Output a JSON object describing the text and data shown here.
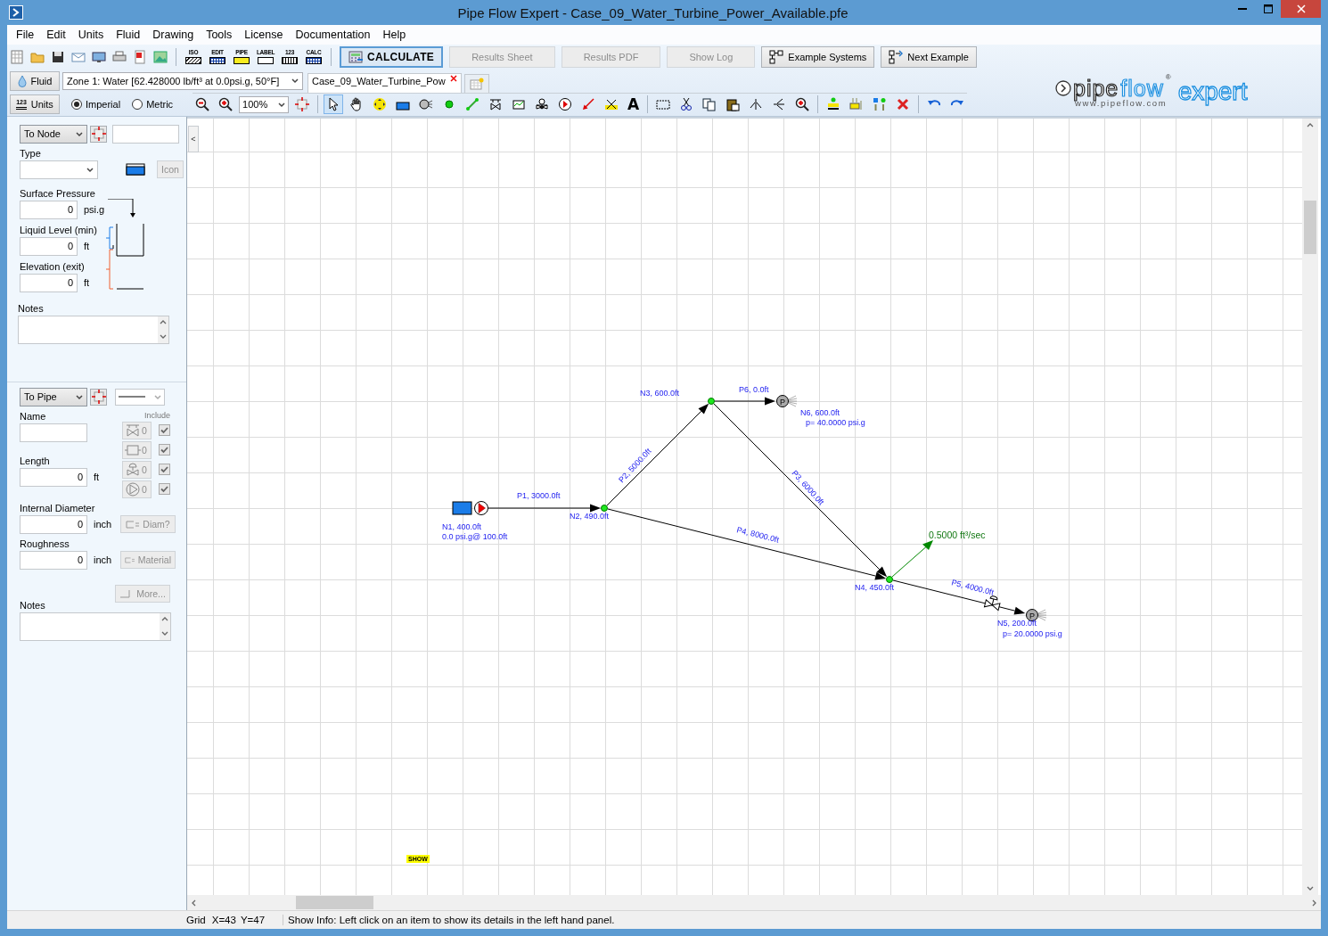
{
  "window": {
    "title": "Pipe Flow Expert - Case_09_Water_Turbine_Power_Available.pfe"
  },
  "menu": [
    "File",
    "Edit",
    "Units",
    "Fluid",
    "Drawing",
    "Tools",
    "License",
    "Documentation",
    "Help"
  ],
  "toolbar": {
    "file_icons": [
      {
        "kind": "new"
      },
      {
        "kind": "open"
      },
      {
        "kind": "save"
      },
      {
        "kind": "email"
      },
      {
        "kind": "export"
      },
      {
        "kind": "print"
      },
      {
        "kind": "pdf"
      },
      {
        "kind": "image"
      }
    ],
    "mode_buttons": [
      {
        "text": "ISO",
        "kind": "hatch"
      },
      {
        "text": "EDIT",
        "kind": "grid"
      },
      {
        "text": "PIPE",
        "kind": "yellow"
      },
      {
        "text": "LABEL",
        "kind": "check"
      },
      {
        "text": "123",
        "kind": "ruler"
      },
      {
        "text": "CALC",
        "kind": "grid"
      }
    ],
    "buttons": [
      {
        "label": "CALCULATE",
        "kind": "calc",
        "disabled": false
      },
      {
        "label": "Results Sheet",
        "kind": "plain",
        "disabled": true
      },
      {
        "label": "Results PDF",
        "kind": "plain",
        "disabled": true
      },
      {
        "label": "Show Log",
        "kind": "plain",
        "disabled": true
      },
      {
        "label": "Example Systems",
        "kind": "tree",
        "disabled": false
      },
      {
        "label": "Next Example",
        "kind": "tree-next",
        "disabled": false
      }
    ]
  },
  "fluid_bar": {
    "button": "Fluid",
    "zone": "Zone 1: Water [62.428000 lb/ft³ at 0.0psi.g, 50°F]"
  },
  "document_tabs": [
    {
      "label": "Case_09_Water_Turbine_Pow",
      "selected": true
    }
  ],
  "units_bar": {
    "button_icon_text": "123",
    "button": "Units",
    "options": [
      {
        "label": "Imperial",
        "selected": true
      },
      {
        "label": "Metric",
        "selected": false
      }
    ]
  },
  "drawing_tool_groups": [
    [
      {
        "kind": "zoom-out",
        "selected": false
      },
      {
        "kind": "zoom-in",
        "selected": false
      },
      {
        "kind": "zoom-level",
        "text": "100%",
        "selected": false
      },
      {
        "kind": "target",
        "selected": false
      }
    ],
    [
      {
        "kind": "pointer",
        "selected": true
      },
      {
        "kind": "hand",
        "selected": false
      },
      {
        "kind": "move",
        "selected": false
      },
      {
        "kind": "tank",
        "selected": false
      },
      {
        "kind": "pressure",
        "selected": false
      },
      {
        "kind": "join",
        "selected": false
      },
      {
        "kind": "pipe",
        "selected": false
      },
      {
        "kind": "component",
        "selected": false
      },
      {
        "kind": "meter",
        "selected": false
      },
      {
        "kind": "valve",
        "selected": false
      },
      {
        "kind": "pump",
        "selected": false
      },
      {
        "kind": "demand",
        "selected": false
      },
      {
        "kind": "crossed",
        "selected": false
      },
      {
        "kind": "text",
        "text": "A",
        "selected": false
      }
    ],
    [
      {
        "kind": "select-rect",
        "selected": false
      },
      {
        "kind": "cut",
        "selected": false
      },
      {
        "kind": "copy",
        "selected": false
      },
      {
        "kind": "paste",
        "selected": false
      },
      {
        "kind": "flip-v",
        "selected": false
      },
      {
        "kind": "flip-h",
        "selected": false
      },
      {
        "kind": "zoom-area",
        "selected": false
      }
    ],
    [
      {
        "kind": "node-bar",
        "selected": false
      },
      {
        "kind": "align",
        "selected": false
      },
      {
        "kind": "spacing",
        "selected": false
      },
      {
        "kind": "delete",
        "selected": false
      }
    ],
    [
      {
        "kind": "undo",
        "selected": false
      },
      {
        "kind": "redo",
        "selected": false
      }
    ]
  ],
  "logo": {
    "word_1": "pipe",
    "word_2": "flow",
    "mark": "®",
    "word_3": "expert",
    "url": "www.pipeflow.com"
  },
  "node_panel": {
    "selector": "To Node",
    "type_label": "Type",
    "icon_button": "Icon",
    "fields": [
      {
        "label": "Surface Pressure",
        "value": "0",
        "unit": "psi.g"
      },
      {
        "label": "Liquid Level (min)",
        "value": "0",
        "unit": "ft"
      },
      {
        "label": "Elevation (exit)",
        "value": "0",
        "unit": "ft"
      }
    ],
    "notes_label": "Notes"
  },
  "pipe_panel": {
    "selector": "To Pipe",
    "name_label": "Name",
    "include_label": "Include",
    "components": [
      {
        "kind": "valve",
        "count": "0",
        "checked": true
      },
      {
        "kind": "box",
        "count": "0",
        "checked": true
      },
      {
        "kind": "control-valve",
        "count": "0",
        "checked": true
      },
      {
        "kind": "pump",
        "count": "0",
        "checked": true
      }
    ],
    "fields": [
      {
        "label": "Length",
        "value": "0",
        "unit": "ft"
      },
      {
        "label": "Internal Diameter",
        "value": "0",
        "unit": "inch",
        "button": "Diam?"
      },
      {
        "label": "Roughness",
        "value": "0",
        "unit": "inch",
        "button": "Material"
      }
    ],
    "more_button": "More...",
    "notes_label": "Notes"
  },
  "canvas": {
    "collapse_button": "<",
    "show_tag": "SHOW",
    "nodes": [
      {
        "kind": "tank",
        "label": "N1, 400.0ft",
        "detail": "0.0 psi.g@ 100.0ft"
      },
      {
        "kind": "join",
        "label": "N2, 490.0ft"
      },
      {
        "kind": "join",
        "label": "N3, 600.0ft"
      },
      {
        "kind": "join",
        "label": "N4, 450.0ft"
      },
      {
        "kind": "pressure",
        "symbol": "P",
        "label": "N5, 200.0ft",
        "detail": "p= 20.0000 psi.g"
      },
      {
        "kind": "pressure",
        "symbol": "P",
        "label": "N6, 600.0ft",
        "detail": "p= 40.0000 psi.g"
      }
    ],
    "pipes": [
      {
        "label": "P1, 3000.0ft",
        "kind": "pump"
      },
      {
        "label": "P2, 5000.0ft",
        "kind": "plain"
      },
      {
        "label": "P3, 6000.0ft",
        "kind": "plain"
      },
      {
        "label": "P4, 8000.0ft",
        "kind": "plain"
      },
      {
        "label": "P5, 4000.0ft",
        "kind": "valve"
      },
      {
        "label": "P6, 0.0ft",
        "kind": "plain"
      }
    ],
    "demand": {
      "label": "0.5000 ft³/sec"
    }
  },
  "status_bar": {
    "grid": "Grid",
    "x": "X=43",
    "y": "Y=47",
    "info": "Show Info: Left click on an item to show its details in the left hand panel."
  }
}
